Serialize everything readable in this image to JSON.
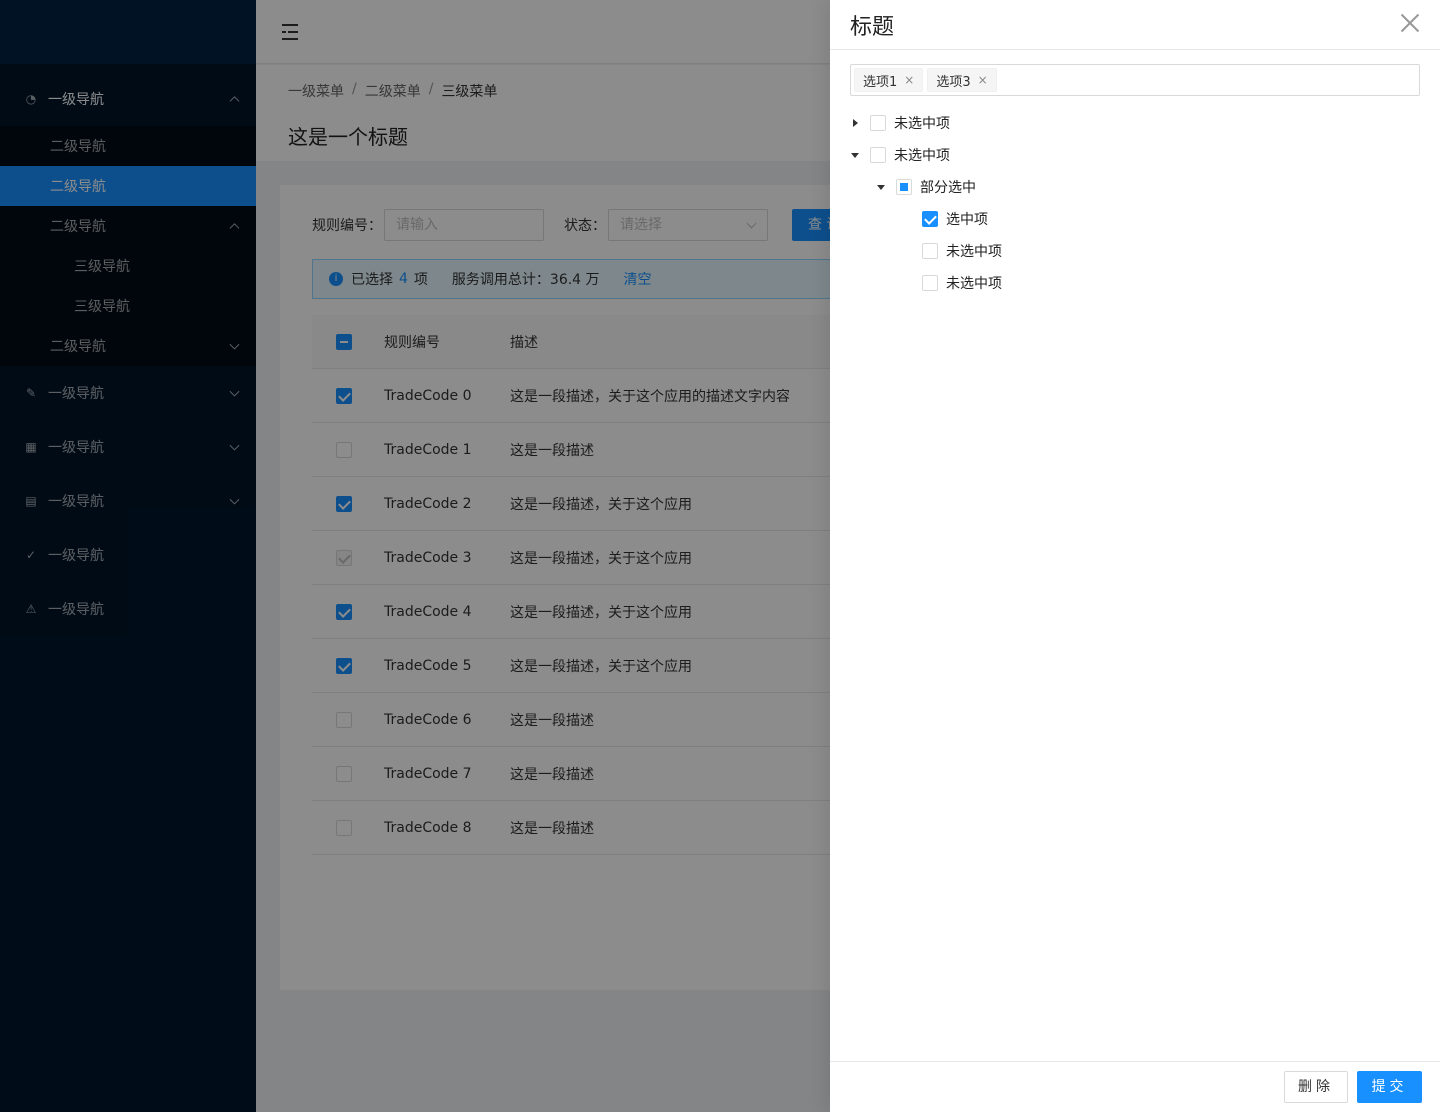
{
  "sidebar": {
    "nav1": {
      "label": "一级导航",
      "icon": "dashboard-icon"
    },
    "sub": [
      {
        "label": "二级导航"
      },
      {
        "label": "二级导航"
      },
      {
        "label": "二级导航"
      }
    ],
    "third": [
      {
        "label": "三级导航"
      },
      {
        "label": "三级导航"
      }
    ],
    "sub4": {
      "label": "二级导航"
    },
    "navs": [
      {
        "label": "一级导航",
        "icon": "edit-icon"
      },
      {
        "label": "一级导航",
        "icon": "table-icon"
      },
      {
        "label": "一级导航",
        "icon": "profile-icon"
      },
      {
        "label": "一级导航",
        "icon": "check-circle-icon"
      },
      {
        "label": "一级导航",
        "icon": "warning-icon"
      }
    ]
  },
  "breadcrumb": {
    "items": [
      "一级菜单",
      "二级菜单",
      "三级菜单"
    ],
    "sep": "/"
  },
  "page_title": "这是一个标题",
  "filter": {
    "rule_label": "规则编号：",
    "rule_placeholder": "请输入",
    "status_label": "状态：",
    "status_placeholder": "请选择",
    "query_button": "查 询"
  },
  "alert": {
    "prefix": "已选择",
    "count": "4",
    "suffix": "项",
    "total": "服务调用总计：36.4 万",
    "clear": "清空"
  },
  "table": {
    "columns": [
      "规则编号",
      "描述"
    ],
    "rows": [
      {
        "code": "TradeCode 0",
        "desc": "这是一段描述，关于这个应用的描述文字内容",
        "state": "checked"
      },
      {
        "code": "TradeCode 1",
        "desc": "这是一段描述",
        "state": "unchecked"
      },
      {
        "code": "TradeCode 2",
        "desc": "这是一段描述，关于这个应用",
        "state": "checked"
      },
      {
        "code": "TradeCode 3",
        "desc": "这是一段描述，关于这个应用",
        "state": "disabled"
      },
      {
        "code": "TradeCode 4",
        "desc": "这是一段描述，关于这个应用",
        "state": "checked"
      },
      {
        "code": "TradeCode 5",
        "desc": "这是一段描述，关于这个应用",
        "state": "checked"
      },
      {
        "code": "TradeCode 6",
        "desc": "这是一段描述",
        "state": "unchecked"
      },
      {
        "code": "TradeCode 7",
        "desc": "这是一段描述",
        "state": "unchecked"
      },
      {
        "code": "TradeCode 8",
        "desc": "这是一段描述",
        "state": "unchecked"
      }
    ]
  },
  "drawer": {
    "title": "标题",
    "tags": [
      "选项1",
      "选项3"
    ],
    "tag_close": "×",
    "tree": [
      {
        "label": "未选中项"
      },
      {
        "label": "未选中项"
      },
      {
        "label": "部分选中"
      },
      {
        "label": "选中项"
      },
      {
        "label": "未选中项"
      },
      {
        "label": "未选中项"
      }
    ],
    "delete_button": "删除",
    "submit_button": "提交"
  },
  "colors": {
    "primary": "#1890ff",
    "sidebar": "#001529"
  }
}
